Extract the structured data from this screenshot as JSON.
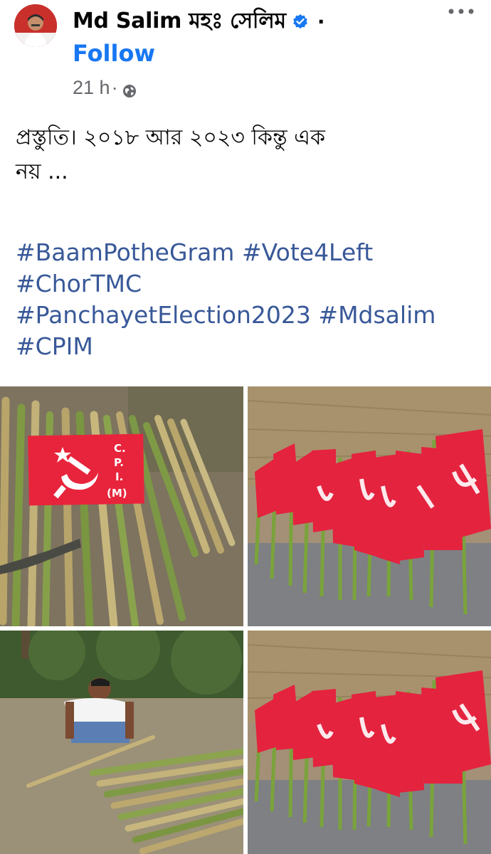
{
  "post": {
    "author_name": "Md Salim মহঃ সেলিম",
    "follow_label": "Follow",
    "time": "21 h",
    "separator": "·",
    "text_line1": "প্রস্তুতি। ২০১৮ আর ২০২৩ কিন্তু এক",
    "text_line2": "নয় ...",
    "hashtags": [
      "#BaamPotheGram",
      "#Vote4Left",
      "#ChorTMC",
      "#PanchayetElection2023",
      "#Mdsalim",
      "#CPIM"
    ]
  },
  "photos": {
    "flag_text_line1": "C.",
    "flag_text_line2": "P.",
    "flag_text_line3": "I.",
    "flag_text_line4": "(M)"
  },
  "icons": {
    "verified": "verified-badge-icon",
    "globe": "globe-icon",
    "more": "more-options-icon"
  },
  "colors": {
    "link_blue": "#1877f2",
    "hashtag_blue": "#385898",
    "meta_gray": "#65676b",
    "flag_red": "#e8243c"
  }
}
